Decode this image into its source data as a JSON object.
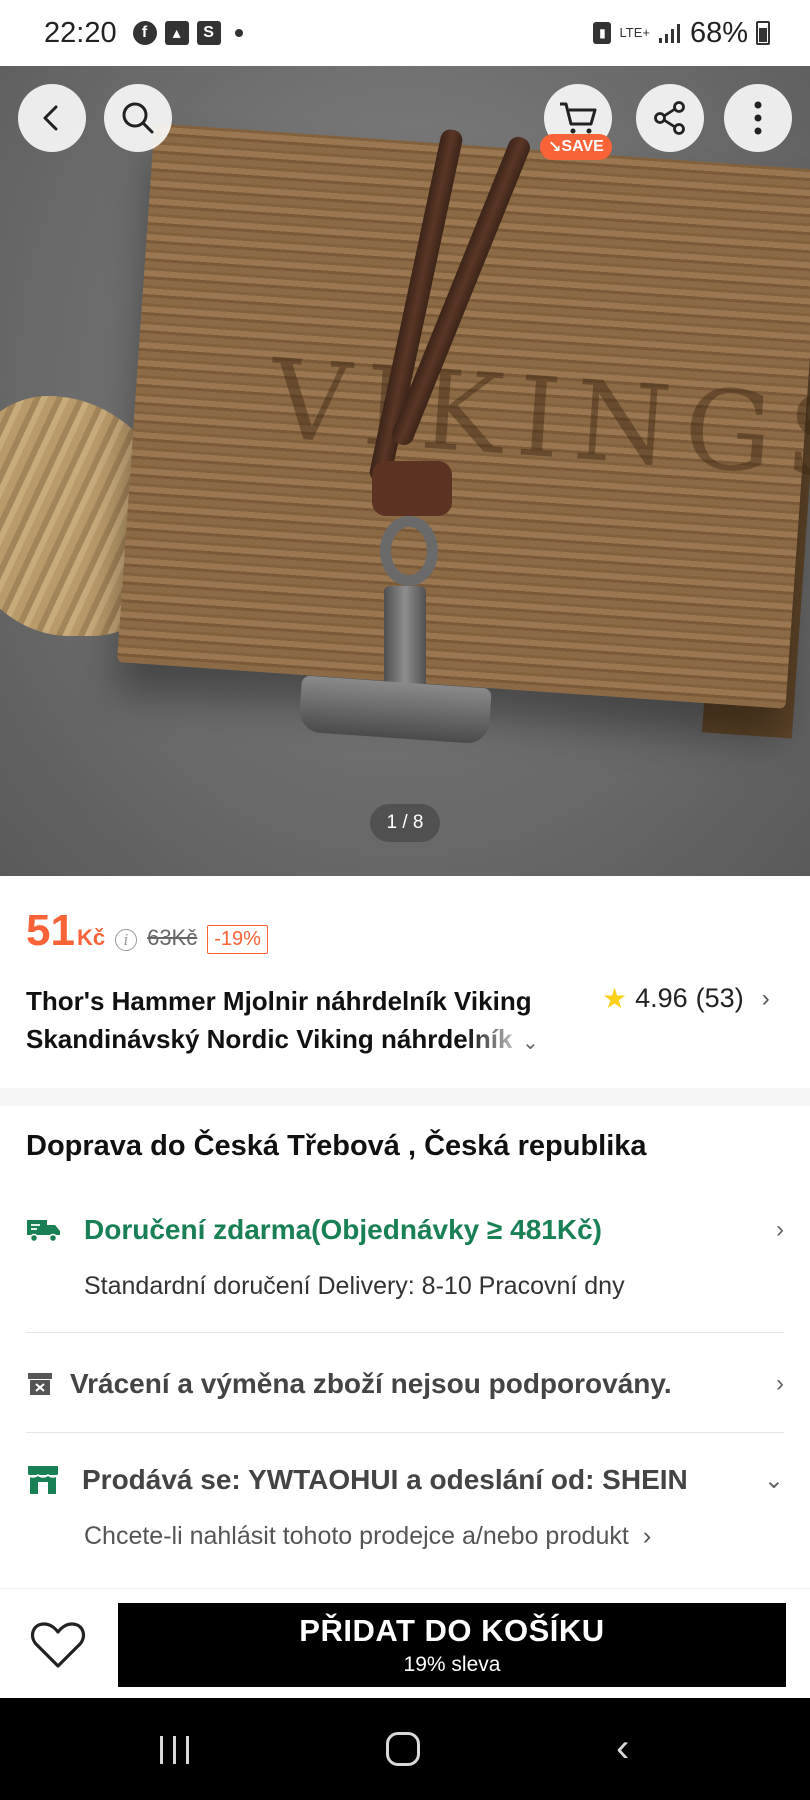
{
  "status_bar": {
    "time": "22:20",
    "network": "LTE+",
    "battery": "68%"
  },
  "hero": {
    "box_engraving": "VIKINGS",
    "pager": "1 / 8",
    "save_badge": "SAVE"
  },
  "product": {
    "price": "51",
    "currency": "Kč",
    "original_price": "63Kč",
    "discount": "-19%",
    "title_line1": "Thor's Hammer Mjolnir náhrdelník Viking",
    "title_line2_solid": "Skandinávský Nordic Viking náhr",
    "title_line2_fade": "delník",
    "rating": "4.96",
    "review_count": "(53)"
  },
  "shipping": {
    "heading": "Doprava do Česká Třebová , Česká republika",
    "free_delivery": "Doručení zdarma(Objednávky ≥ 481Kč)",
    "standard": "Standardní doručení Delivery: 8-10 Pracovní dny",
    "returns": "Vrácení a výměna zboží nejsou podporovány.",
    "seller": "Prodává se: YWTAOHUI a odeslání od: SHEIN",
    "report": "Chcete-li nahlásit tohoto prodejce a/nebo produkt"
  },
  "actions": {
    "add_to_cart": "PŘIDAT DO KOŠÍKU",
    "discount_note": "19% sleva"
  },
  "colors": {
    "price": "#fa6338",
    "free_shipping": "#198055",
    "star": "#facf19",
    "cta": "#000000"
  }
}
